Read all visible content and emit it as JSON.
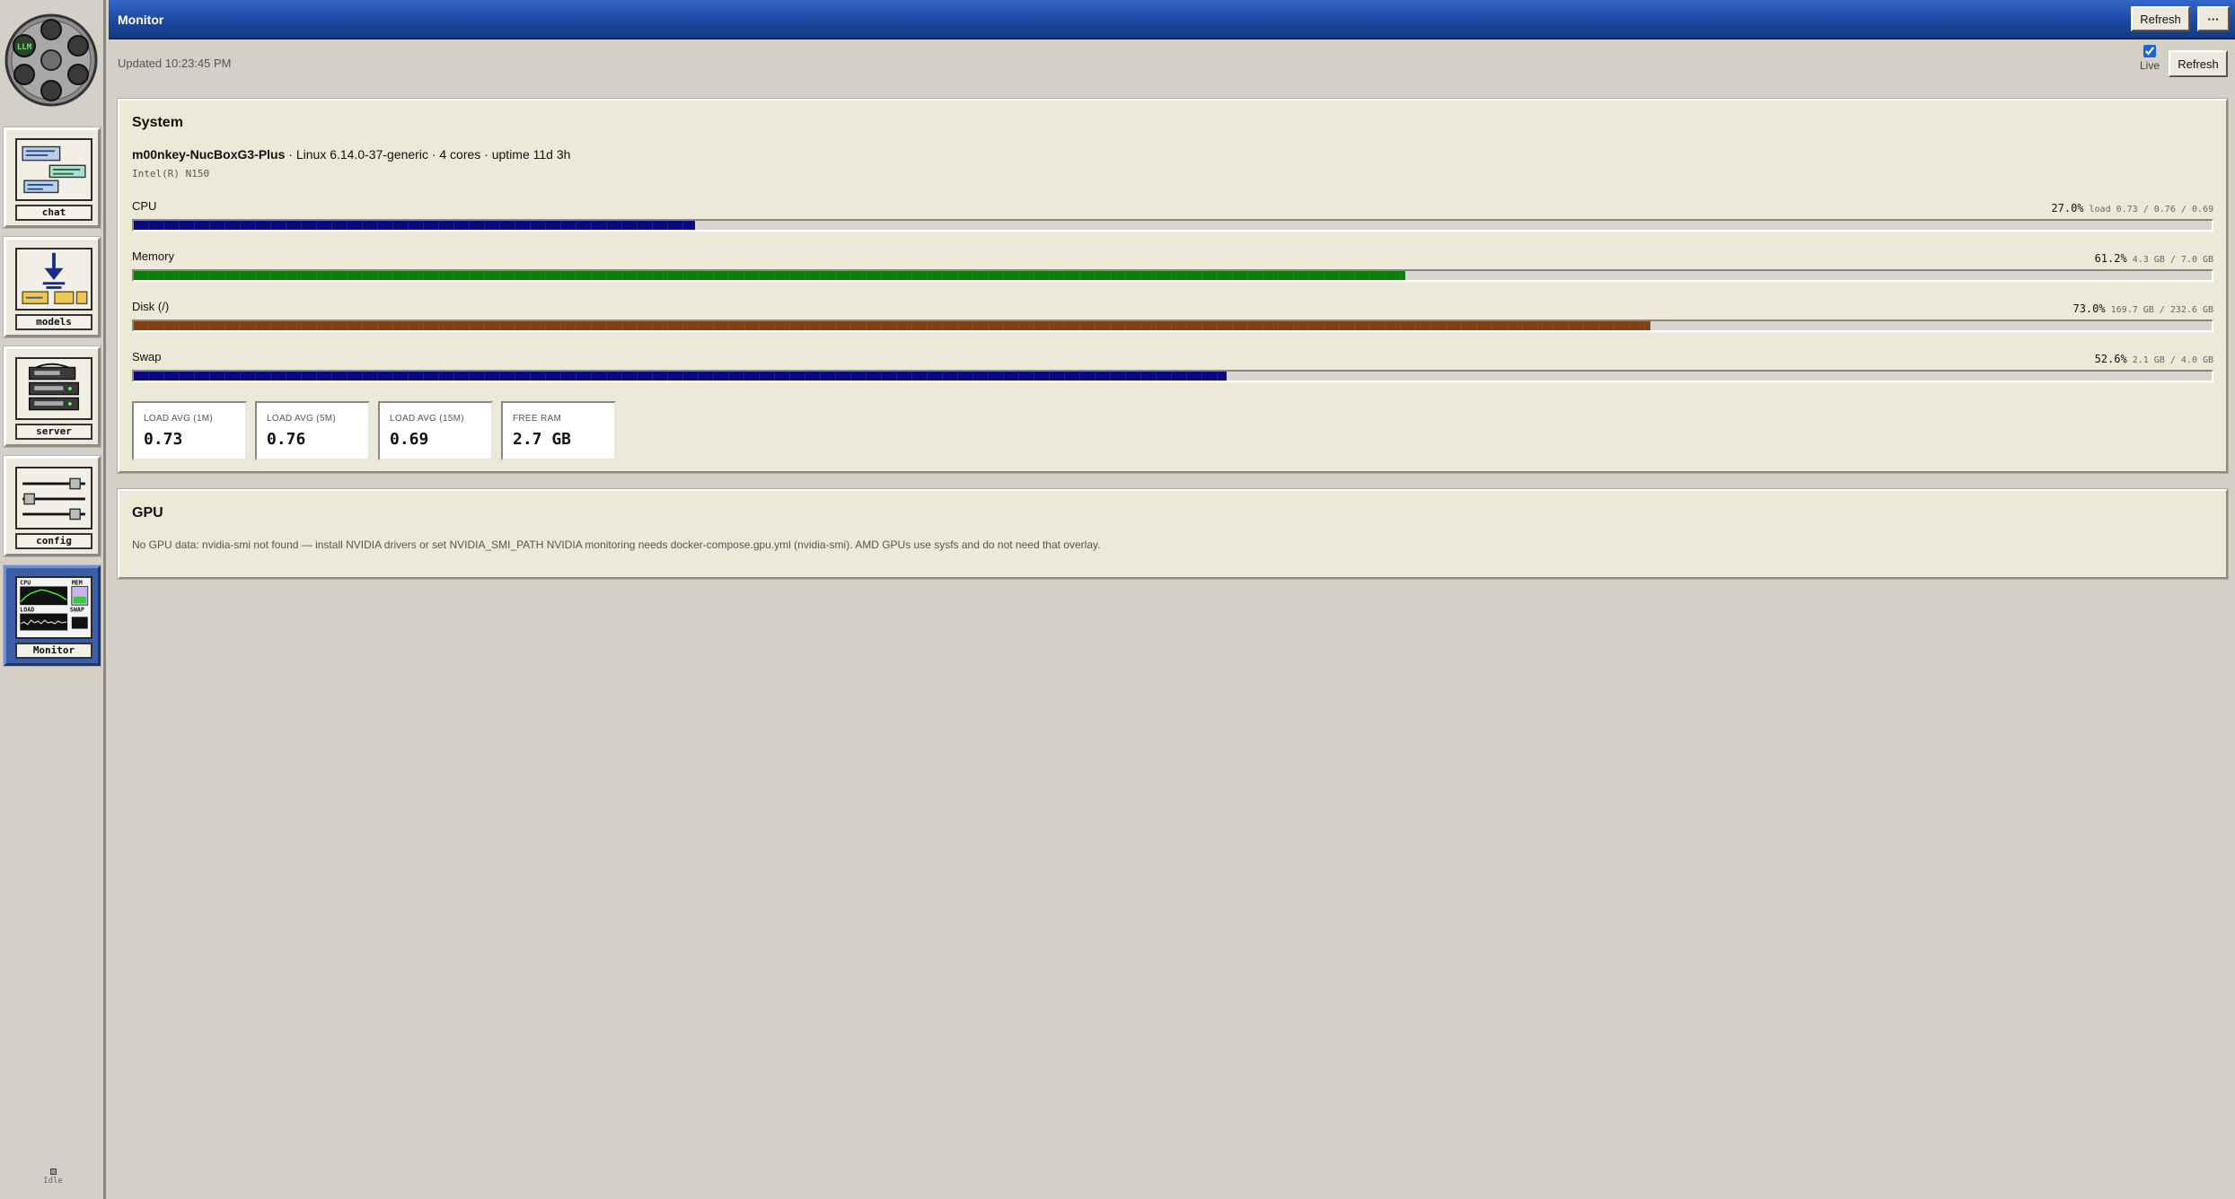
{
  "window": {
    "title": "Monitor",
    "refresh_label": "Refresh",
    "more_label": "···"
  },
  "header": {
    "updated": "Updated 10:23:45 PM",
    "live_label": "Live",
    "live_checked": true,
    "refresh_label": "Refresh"
  },
  "sidebar": {
    "logo_text": "LLM",
    "items": [
      {
        "label": "chat",
        "icon": "chat-bubbles-icon",
        "active": false
      },
      {
        "label": "models",
        "icon": "models-download-icon",
        "active": false
      },
      {
        "label": "server",
        "icon": "server-rack-icon",
        "active": false
      },
      {
        "label": "config",
        "icon": "sliders-icon",
        "active": false
      },
      {
        "label": "Monitor",
        "icon": "monitor-graphs-icon",
        "active": true
      }
    ],
    "monitor_thumb": {
      "cpu": "CPU",
      "mem": "MEM",
      "load": "LOAD",
      "swap": "SWAP"
    },
    "status": "Idle"
  },
  "system": {
    "title": "System",
    "hostname": "m00nkey-NucBoxG3-Plus",
    "host_details": " · Linux 6.14.0-37-generic · 4 cores · uptime 11d 3h",
    "cpu_model": "Intel(R) N150",
    "metrics": [
      {
        "label": "CPU",
        "percent_text": "27.0%",
        "detail": "load 0.73 / 0.76 / 0.69",
        "fraction": 0.27,
        "color": "#0a0a80"
      },
      {
        "label": "Memory",
        "percent_text": "61.2%",
        "detail": "4.3 GB / 7.0 GB",
        "fraction": 0.612,
        "color": "#0a800a"
      },
      {
        "label": "Disk (/)",
        "percent_text": "73.0%",
        "detail": "169.7 GB / 232.6 GB",
        "fraction": 0.73,
        "color": "#804010"
      },
      {
        "label": "Swap",
        "percent_text": "52.6%",
        "detail": "2.1 GB / 4.0 GB",
        "fraction": 0.526,
        "color": "#0a0a80"
      }
    ],
    "stats": [
      {
        "label": "LOAD AVG (1M)",
        "value": "0.73"
      },
      {
        "label": "LOAD AVG (5M)",
        "value": "0.76"
      },
      {
        "label": "LOAD AVG (15M)",
        "value": "0.69"
      },
      {
        "label": "FREE RAM",
        "value": "2.7 GB"
      }
    ]
  },
  "gpu": {
    "title": "GPU",
    "message": "No GPU data: nvidia-smi not found — install NVIDIA drivers or set NVIDIA_SMI_PATH NVIDIA monitoring needs docker-compose.gpu.yml (nvidia-smi). AMD GPUs use sysfs and do not need that overlay."
  }
}
